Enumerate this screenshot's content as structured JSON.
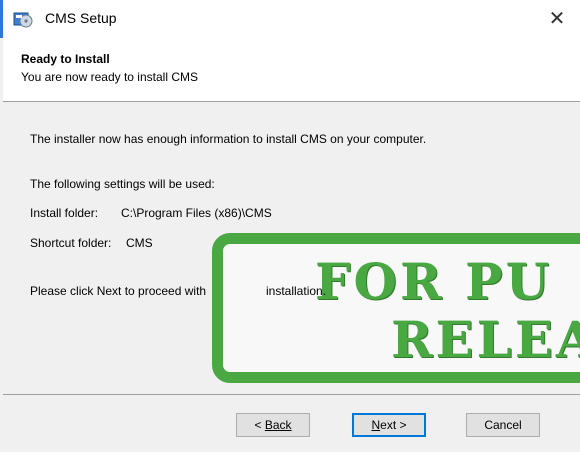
{
  "window": {
    "title": "CMS Setup",
    "close_glyph": "✕"
  },
  "header": {
    "title": "Ready to Install",
    "subtitle": "You are now ready to install CMS"
  },
  "content": {
    "intro": "The installer now has enough information to install CMS on your computer.",
    "settings_label": "The following settings will be used:",
    "install_folder_label": "Install folder:",
    "install_folder_value": "C:\\Program Files (x86)\\CMS",
    "shortcut_folder_label": "Shortcut folder:",
    "shortcut_folder_value": "CMS",
    "proceed_text_a": "Please click Next to proceed with",
    "proceed_text_b": "installation."
  },
  "buttons": {
    "back_rest": "Back",
    "back_prefix": "< ",
    "next_mnemonic": "N",
    "next_rest": "ext >",
    "cancel_label": "Cancel"
  },
  "stamp": {
    "line1": "FOR PU",
    "line2": "RELEA",
    "color": "#4aa843"
  },
  "icons": {
    "app": "setup-disk-icon",
    "close": "close-icon"
  }
}
